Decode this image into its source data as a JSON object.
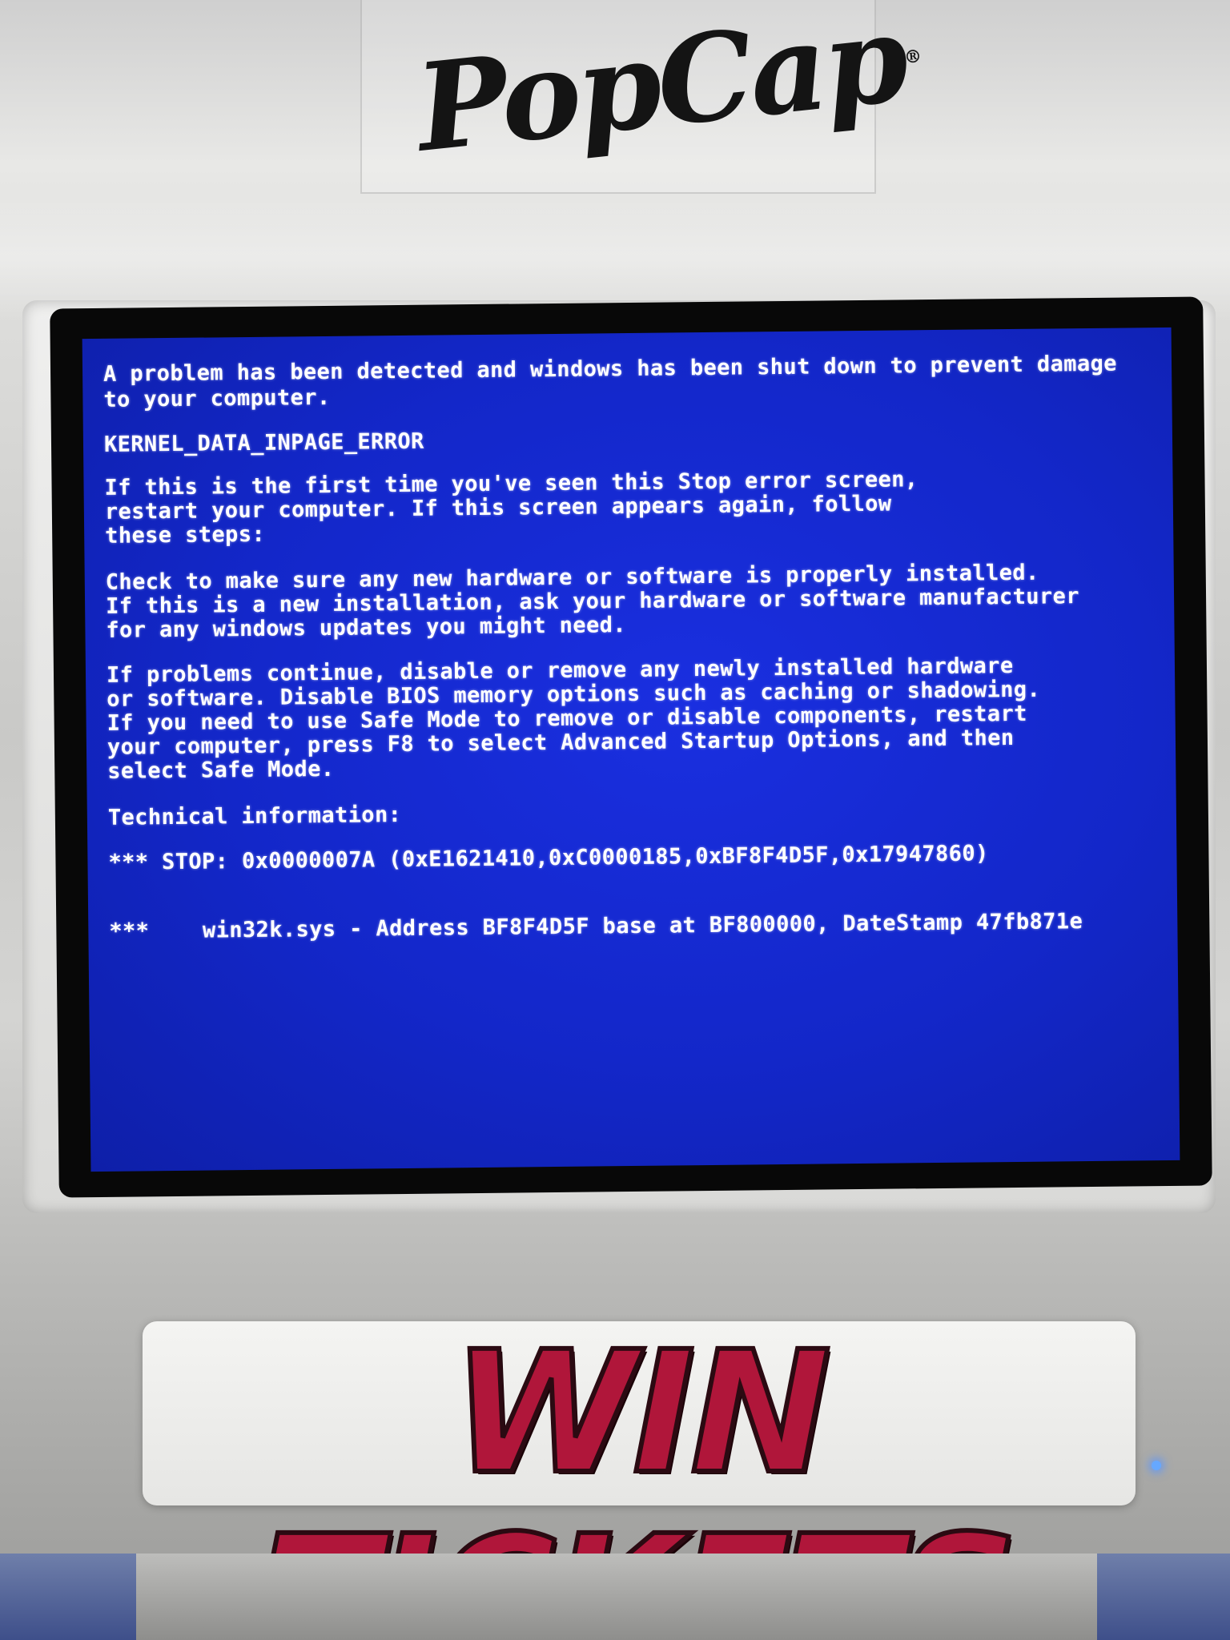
{
  "brand": {
    "logo_text": "PopCap",
    "logo_mark": "®"
  },
  "bsod": {
    "lines": [
      "A problem has been detected and windows has been shut down to prevent damage",
      "to your computer.",
      "KERNEL_DATA_INPAGE_ERROR",
      "If this is the first time you've seen this Stop error screen,",
      "restart your computer. If this screen appears again, follow",
      "these steps:",
      "Check to make sure any new hardware or software is properly installed.",
      "If this is a new installation, ask your hardware or software manufacturer",
      "for any windows updates you might need.",
      "If problems continue, disable or remove any newly installed hardware",
      "or software. Disable BIOS memory options such as caching or shadowing.",
      "If you need to use Safe Mode to remove or disable components, restart",
      "your computer, press F8 to select Advanced Startup Options, and then",
      "select Safe Mode.",
      "Technical information:",
      "*** STOP: 0x0000007A (0xE1621410,0xC0000185,0xBF8F4D5F,0x17947860)",
      "***    win32k.sys - Address BF8F4D5F base at BF800000, DateStamp 47fb871e"
    ],
    "background_color": "#1327c9",
    "text_color": "#ffffff"
  },
  "cabinet": {
    "sign_text": "WIN TICKETS",
    "sign_color": "#b0163a"
  }
}
